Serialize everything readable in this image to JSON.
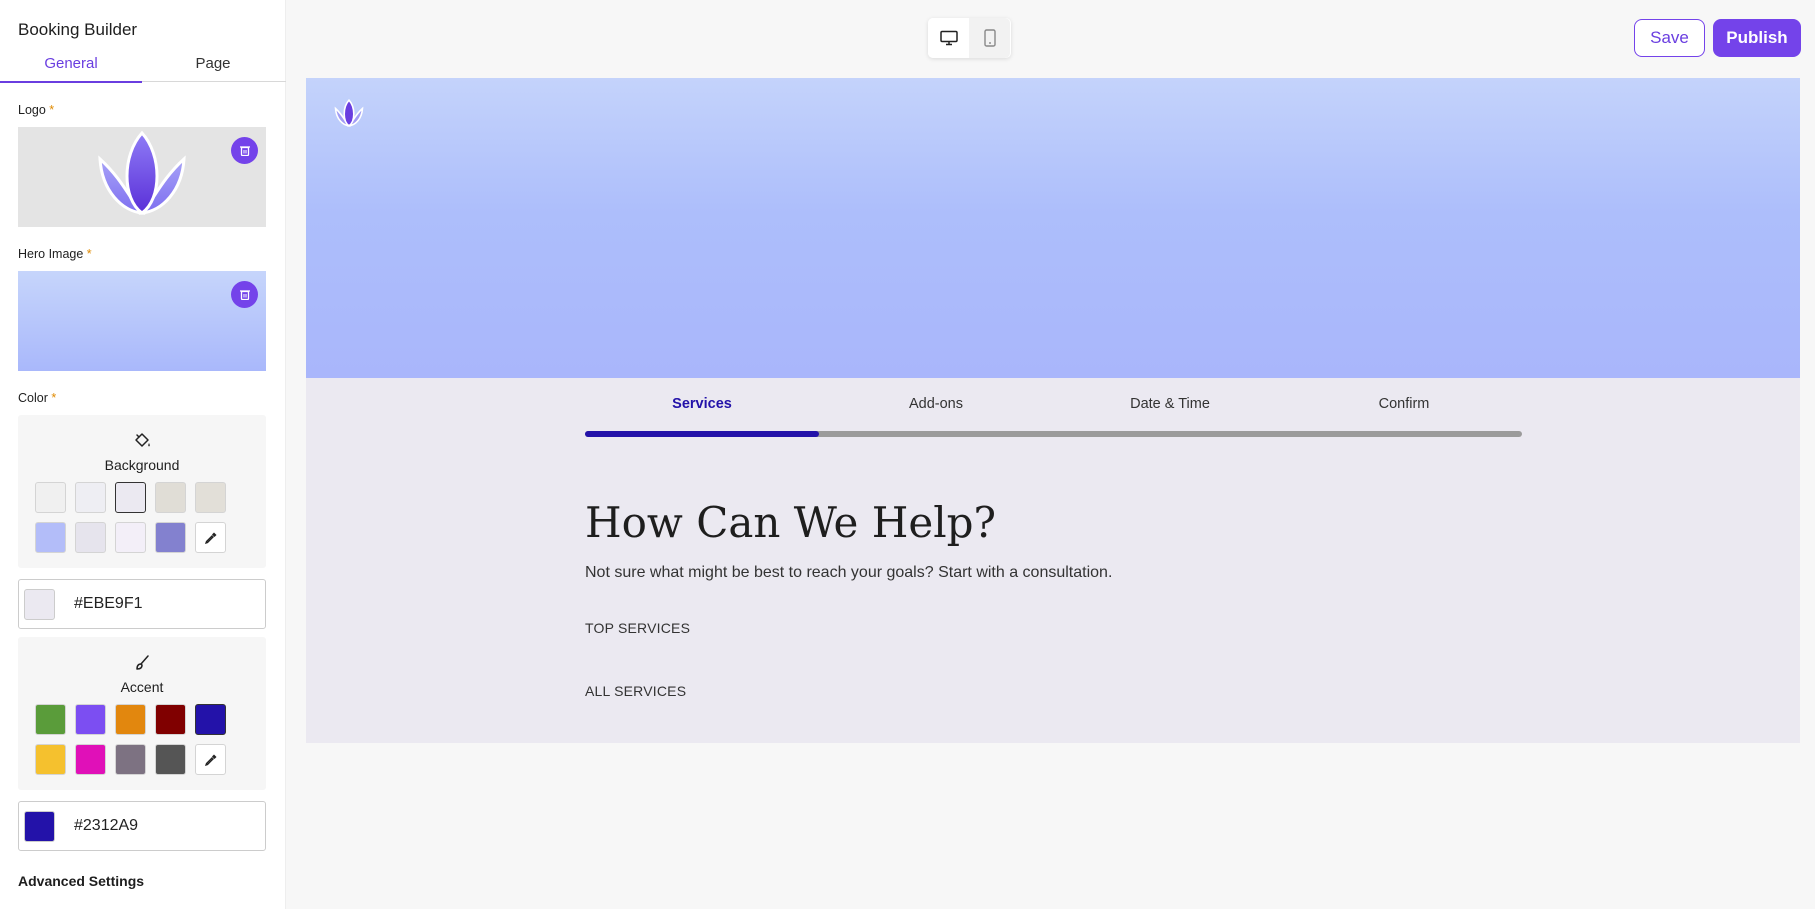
{
  "app": {
    "title": "Booking Builder"
  },
  "tabs": [
    {
      "label": "General"
    },
    {
      "label": "Page"
    }
  ],
  "logo": {
    "label": "Logo",
    "required_mark": "*"
  },
  "hero_image": {
    "label": "Hero Image",
    "required_mark": "*"
  },
  "color": {
    "label": "Color",
    "required_mark": "*",
    "background": {
      "label": "Background",
      "icon": "paint-bucket-icon",
      "swatches": [
        "#f0f0f0",
        "#eeeef3",
        "#ebe9f1",
        "#e0ddd6",
        "#e2dfd8",
        "#b3bdf9",
        "#e6e4ed",
        "#f3eff8",
        "#8381cf"
      ],
      "selected": "#ebe9f1",
      "hex_value": "#EBE9F1"
    },
    "accent": {
      "label": "Accent",
      "icon": "paint-brush-icon",
      "swatches": [
        "#5a9c3a",
        "#7c4ef2",
        "#e2870e",
        "#800000",
        "#2312a9",
        "#f5c12e",
        "#e010b8",
        "#7d7282",
        "#555555"
      ],
      "selected": "#2312a9",
      "hex_value": "#2312A9"
    },
    "picker_icon": "eyedropper-icon"
  },
  "advanced": {
    "label": "Advanced Settings"
  },
  "toolbar": {
    "desktop_icon": "desktop-icon",
    "mobile_icon": "mobile-icon",
    "save_label": "Save",
    "publish_label": "Publish"
  },
  "preview": {
    "steps": [
      {
        "label": "Services"
      },
      {
        "label": "Add-ons"
      },
      {
        "label": "Date & Time"
      },
      {
        "label": "Confirm"
      }
    ],
    "progress": 0.25,
    "title": "How Can We Help?",
    "subtitle": "Not sure what might be best to reach your goals? Start with a consultation.",
    "top_services": "TOP SERVICES",
    "all_services": "ALL SERVICES"
  }
}
